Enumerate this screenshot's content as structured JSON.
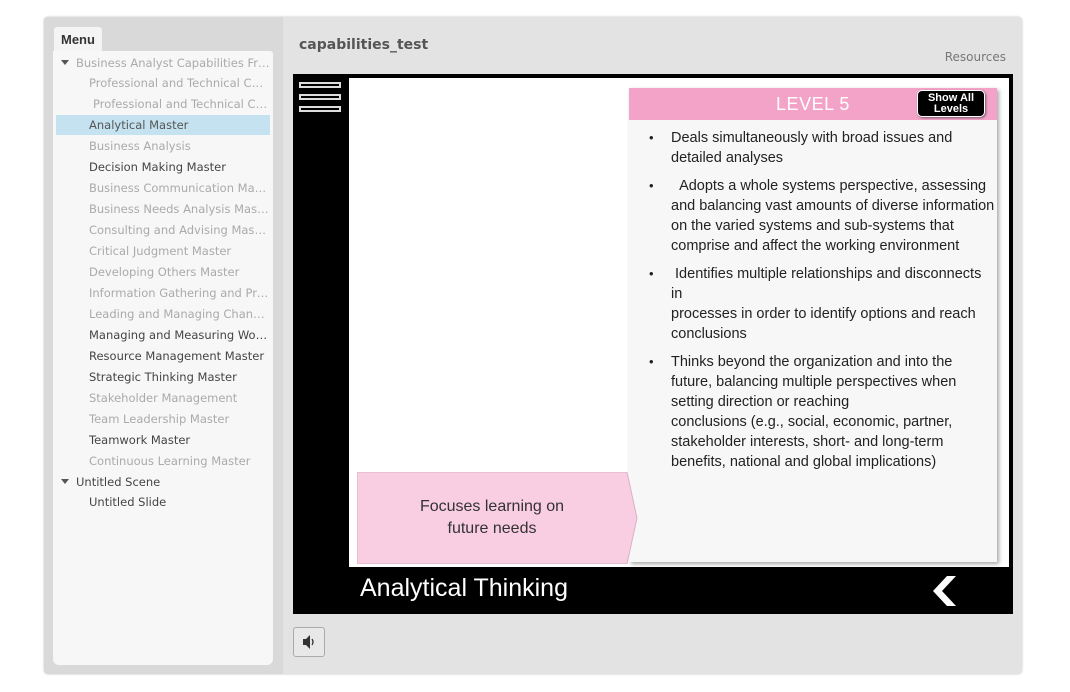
{
  "app": {
    "project_title": "capabilities_test",
    "resources_label": "Resources"
  },
  "menu": {
    "tab_label": "Menu",
    "items": [
      {
        "label": "Business Analyst Capabilities Fra..."
      },
      {
        "label": "Professional and Technical Cap..."
      },
      {
        "label": "Professional and Technical Cap..."
      },
      {
        "label": "Analytical Master"
      },
      {
        "label": "Business Analysis"
      },
      {
        "label": "Decision Making Master"
      },
      {
        "label": "Business Communication Master"
      },
      {
        "label": "Business Needs Analysis Master"
      },
      {
        "label": "Consulting and Advising  Master"
      },
      {
        "label": "Critical Judgment Master"
      },
      {
        "label": "Developing Others Master"
      },
      {
        "label": "Information Gathering and Proc..."
      },
      {
        "label": "Leading and Managing Change ..."
      },
      {
        "label": "Managing and Measuring Work ..."
      },
      {
        "label": "Resource Management Master"
      },
      {
        "label": "Strategic Thinking Master"
      },
      {
        "label": "Stakeholder Management"
      },
      {
        "label": "Team Leadership Master"
      },
      {
        "label": "Teamwork Master"
      },
      {
        "label": "Continuous Learning Master"
      },
      {
        "label": "Untitled Scene"
      },
      {
        "label": "Untitled Slide"
      }
    ]
  },
  "slide": {
    "level_title": "LEVEL 5",
    "show_all_line1": "Show All",
    "show_all_line2": "Levels",
    "bullets": [
      "Deals simultaneously with broad issues and detailed analyses",
      "  Adopts a whole systems perspective, assessing and balancing vast amounts of diverse information on the varied systems and sub-systems that comprise and affect the working environment",
      " Identifies multiple relationships and disconnects in\nprocesses in order to identify options and reach conclusions",
      "Thinks beyond the organization and into the future, balancing multiple perspectives when setting direction or reaching\nconclusions (e.g., social, economic, partner, stakeholder interests, short- and long-term benefits, national and global implications)"
    ],
    "callout_line1": "Focuses learning on",
    "callout_line2": "future needs",
    "stage_title": "Analytical Thinking"
  },
  "colors": {
    "level_header": "#f4a3c8",
    "callout_fill": "#f9cde2",
    "selected_item": "#c5e2f0"
  },
  "icons": {
    "hamburger": "hamburger-menu-icon",
    "back": "chevron-left-icon",
    "audio": "speaker-icon"
  }
}
